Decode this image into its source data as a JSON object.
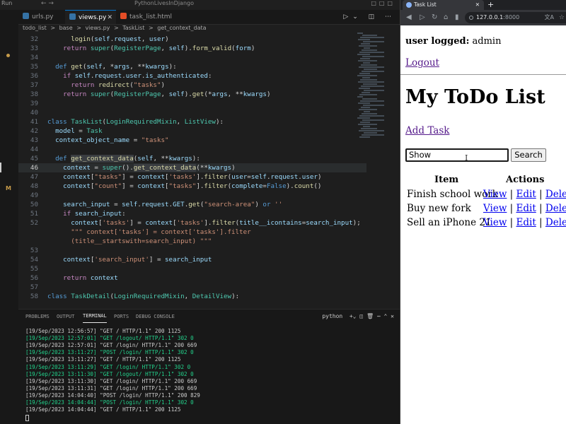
{
  "vscode": {
    "title_run": "Run",
    "project_title": "PythonLivesInDjango",
    "tabs": [
      {
        "label": "urls.py",
        "icon_color": "#3572a5"
      },
      {
        "label": "views.py",
        "icon_color": "#3572a5",
        "close": "✕"
      },
      {
        "label": "task_list.html",
        "icon_color": "#e44d26"
      }
    ],
    "breadcrumb": [
      "todo_list",
      ">",
      "base",
      ">",
      "views.py",
      ">",
      "TaskList",
      ">",
      "get_context_data"
    ],
    "code_lines": [
      {
        "n": "32",
        "html": "      <span class='fn'>login</span>(<span class='self'>self</span>.<span class='var'>request</span>, <span class='var'>user</span>)"
      },
      {
        "n": "33",
        "html": "    <span class='kw2'>return</span> <span class='cls'>super</span>(<span class='cls'>RegisterPage</span>, <span class='self'>self</span>).<span class='fn'>form_valid</span>(<span class='var'>form</span>)"
      },
      {
        "n": "34",
        "html": ""
      },
      {
        "n": "35",
        "html": "  <span class='kw'>def</span> <span class='fn'>get</span>(<span class='self'>self</span>, *<span class='var'>args</span>, **<span class='var'>kwargs</span>):"
      },
      {
        "n": "36",
        "html": "    <span class='kw2'>if</span> <span class='self'>self</span>.<span class='var'>request</span>.<span class='var'>user</span>.<span class='var'>is_authenticated</span>:"
      },
      {
        "n": "37",
        "html": "      <span class='kw2'>return</span> <span class='fn'>redirect</span>(<span class='str'>\"tasks\"</span>)"
      },
      {
        "n": "38",
        "html": "    <span class='kw2'>return</span> <span class='cls'>super</span>(<span class='cls'>RegisterPage</span>, <span class='self'>self</span>).<span class='fn'>get</span>(*<span class='var'>args</span>, **<span class='var'>kwargs</span>)"
      },
      {
        "n": "39",
        "html": ""
      },
      {
        "n": "40",
        "html": ""
      },
      {
        "n": "41",
        "html": "<span class='kw'>class</span> <span class='cls'>TaskList</span>(<span class='cls'>LoginRequiredMixin</span>, <span class='cls'>ListView</span>):"
      },
      {
        "n": "42",
        "html": "  <span class='var'>model</span> = <span class='cls'>Task</span>"
      },
      {
        "n": "43",
        "html": "  <span class='var'>context_object_name</span> = <span class='str'>\"tasks\"</span>"
      },
      {
        "n": "44",
        "html": ""
      },
      {
        "n": "45",
        "html": "  <span class='kw'>def</span> <span class='fn hl'>get_context_data</span>(<span class='self'>self</span>, **<span class='var'>kwargs</span>):"
      },
      {
        "n": "46",
        "html": "    <span class='var'>context</span> = <span class='cls'>super</span>().<span class='fn hl'>get_context_data</span>(**<span class='var'>kwargs</span>)",
        "current": true
      },
      {
        "n": "47",
        "html": "    <span class='var'>context</span>[<span class='str'>\"tasks\"</span>] = <span class='var'>context</span>[<span class='str'>'tasks'</span>].<span class='fn'>filter</span>(<span class='var'>user</span>=<span class='self'>self</span>.<span class='var'>request</span>.<span class='var'>user</span>)"
      },
      {
        "n": "48",
        "html": "    <span class='var'>context</span>[<span class='str'>\"count\"</span>] = <span class='var'>context</span>[<span class='str'>\"tasks\"</span>].<span class='fn'>filter</span>(<span class='var'>complete</span>=<span class='kw'>False</span>).<span class='fn'>count</span>()"
      },
      {
        "n": "49",
        "html": ""
      },
      {
        "n": "50",
        "html": "    <span class='var'>search_input</span> = <span class='self'>self</span>.<span class='var'>request</span>.<span class='var'>GET</span>.<span class='fn'>get</span>(<span class='str'>\"search-area\"</span>) <span class='kw'>or</span> <span class='str'>''</span>"
      },
      {
        "n": "51",
        "html": "    <span class='kw2'>if</span> <span class='var'>search_input</span>:"
      },
      {
        "n": "52",
        "html": "      <span class='var'>context</span>[<span class='str'>'tasks'</span>] = <span class='var'>context</span>[<span class='str'>'tasks'</span>].<span class='fn'>filter</span>(<span class='var'>title__icontains</span>=<span class='var'>search_input</span>);"
      },
      {
        "n": "",
        "html": "      <span class='str'>\"\"\" context['tasks'] = context['tasks'].filter</span>"
      },
      {
        "n": "",
        "html": "      <span class='str'>(title__startswith=search_input) \"\"\"</span>"
      },
      {
        "n": "53",
        "html": ""
      },
      {
        "n": "54",
        "html": "    <span class='var'>context</span>[<span class='str'>'search_input'</span>] = <span class='var'>search_input</span>"
      },
      {
        "n": "55",
        "html": ""
      },
      {
        "n": "56",
        "html": "    <span class='kw2'>return</span> <span class='var'>context</span>"
      },
      {
        "n": "57",
        "html": ""
      },
      {
        "n": "58",
        "html": "<span class='kw'>class</span> <span class='cls'>TaskDetail</span>(<span class='cls'>LoginRequiredMixin</span>, <span class='cls'>DetailView</span>):"
      }
    ],
    "panel_tabs": [
      "PROBLEMS",
      "OUTPUT",
      "TERMINAL",
      "PORTS",
      "DEBUG CONSOLE"
    ],
    "panel_active": "TERMINAL",
    "terminal_shell": "python",
    "terminal_lines": [
      {
        "text": "[19/Sep/2023 12:56:57] \"GET / HTTP/1.1\" 200 1125",
        "green": false
      },
      {
        "text": "[19/Sep/2023 12:57:01] \"GET /logout/ HTTP/1.1\" 302 0",
        "green": true
      },
      {
        "text": "[19/Sep/2023 12:57:01] \"GET /login/ HTTP/1.1\" 200 669",
        "green": false
      },
      {
        "text": "[19/Sep/2023 13:11:27] \"POST /login/ HTTP/1.1\" 302 0",
        "green": true
      },
      {
        "text": "[19/Sep/2023 13:11:27] \"GET / HTTP/1.1\" 200 1125",
        "green": false
      },
      {
        "text": "[19/Sep/2023 13:11:29] \"GET /login/ HTTP/1.1\" 302 0",
        "green": true
      },
      {
        "text": "[19/Sep/2023 13:11:30] \"GET /logout/ HTTP/1.1\" 302 0",
        "green": true
      },
      {
        "text": "[19/Sep/2023 13:11:30] \"GET /login/ HTTP/1.1\" 200 669",
        "green": false
      },
      {
        "text": "[19/Sep/2023 13:11:31] \"GET /login/ HTTP/1.1\" 200 669",
        "green": false
      },
      {
        "text": "[19/Sep/2023 14:04:40] \"POST /login/ HTTP/1.1\" 200 829",
        "green": false
      },
      {
        "text": "[19/Sep/2023 14:04:44] \"POST /login/ HTTP/1.1\" 302 0",
        "green": true
      },
      {
        "text": "[19/Sep/2023 14:04:44] \"GET / HTTP/1.1\" 200 1125",
        "green": false
      }
    ]
  },
  "browser": {
    "tab_title": "Task List",
    "new_tab": "+",
    "tab_close": "✕",
    "url_host": "127.0.0.1",
    "url_port": ":8000"
  },
  "page": {
    "user_label": "user logged:",
    "username": "admin",
    "logout": "Logout",
    "title": "My ToDo List",
    "add_task": "Add Task",
    "search_value": "Show",
    "search_button": "Search",
    "col_item": "Item",
    "col_actions": "Actions",
    "rows": [
      {
        "item": "Finish school work",
        "view": "View",
        "edit": "Edit",
        "delete": "Delete"
      },
      {
        "item": "Buy new fork",
        "view": "View",
        "edit": "Edit",
        "delete": "Delete"
      },
      {
        "item": "Sell an iPhone 21",
        "view": "View",
        "edit": "Edit",
        "delete": "Delete"
      }
    ],
    "separator": "|"
  }
}
